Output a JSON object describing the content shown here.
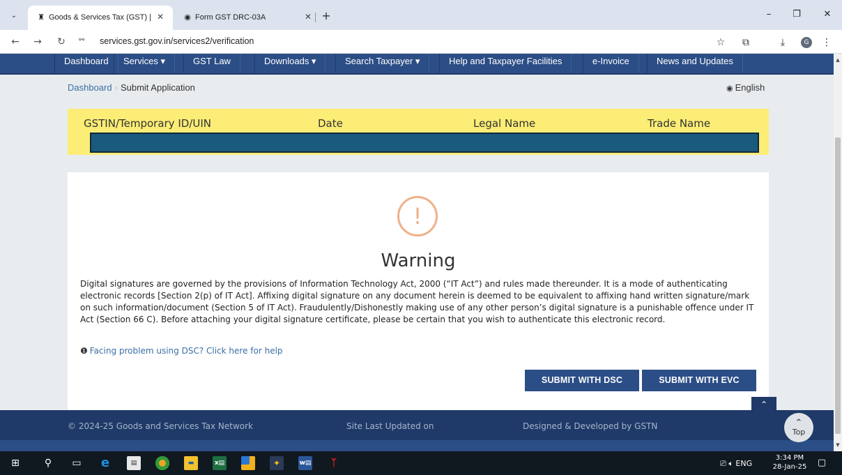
{
  "browser": {
    "tabs": [
      {
        "title": "Goods & Services Tax (GST) | Se",
        "active": true
      },
      {
        "title": "Form GST DRC-03A",
        "active": false
      }
    ],
    "url": "services.gst.gov.in/services2/verification"
  },
  "site_nav": {
    "items": [
      {
        "label": "Dashboard"
      },
      {
        "label": "Services ▾"
      },
      {
        "label": "GST Law"
      },
      {
        "label": "Downloads ▾"
      },
      {
        "label": "Search Taxpayer ▾"
      },
      {
        "label": "Help and Taxpayer Facilities"
      },
      {
        "label": "e-Invoice"
      },
      {
        "label": "News and Updates"
      }
    ]
  },
  "breadcrumb": {
    "home": "Dashboard",
    "current": "Submit Application"
  },
  "language": "English",
  "info_header": {
    "gstin": "GSTIN/Temporary ID/UIN",
    "date": "Date",
    "legal_name": "Legal Name",
    "trade_name": "Trade Name"
  },
  "warning": {
    "title": "Warning",
    "text": "Digital signatures are governed by the provisions of Information Technology Act, 2000 (“IT Act”) and rules made thereunder. It is a mode of authenticating electronic records [Section 2(p) of IT Act]. Affixing digital signature on any document herein is deemed to be equivalent to affixing hand written signature/mark on such information/document (Section 5 of IT Act). Fraudulently/Dishonestly making use of any other person’s digital signature is a punishable offence under IT Act (Section 66 C). Before attaching your digital signature certificate, please be certain that you wish to authenticate this electronic record.",
    "help_link": "Facing problem using DSC? Click here for help"
  },
  "actions": {
    "dsc": "SUBMIT WITH DSC",
    "evc": "SUBMIT WITH EVC"
  },
  "footer": {
    "copyright": "© 2024-25 Goods and Services Tax Network",
    "updated": "Site Last Updated on",
    "designed": "Designed & Developed by GSTN",
    "top_label": "Top"
  },
  "taskbar": {
    "lang": "ENG",
    "time": "3:34 PM",
    "date": "28-Jan-25"
  },
  "colors": {
    "nav": "#2c4e86",
    "info_bg": "#fbed75",
    "info_bar": "#1a5a7e",
    "warn_icon": "#f0b088",
    "footer": "#1f3a68"
  }
}
